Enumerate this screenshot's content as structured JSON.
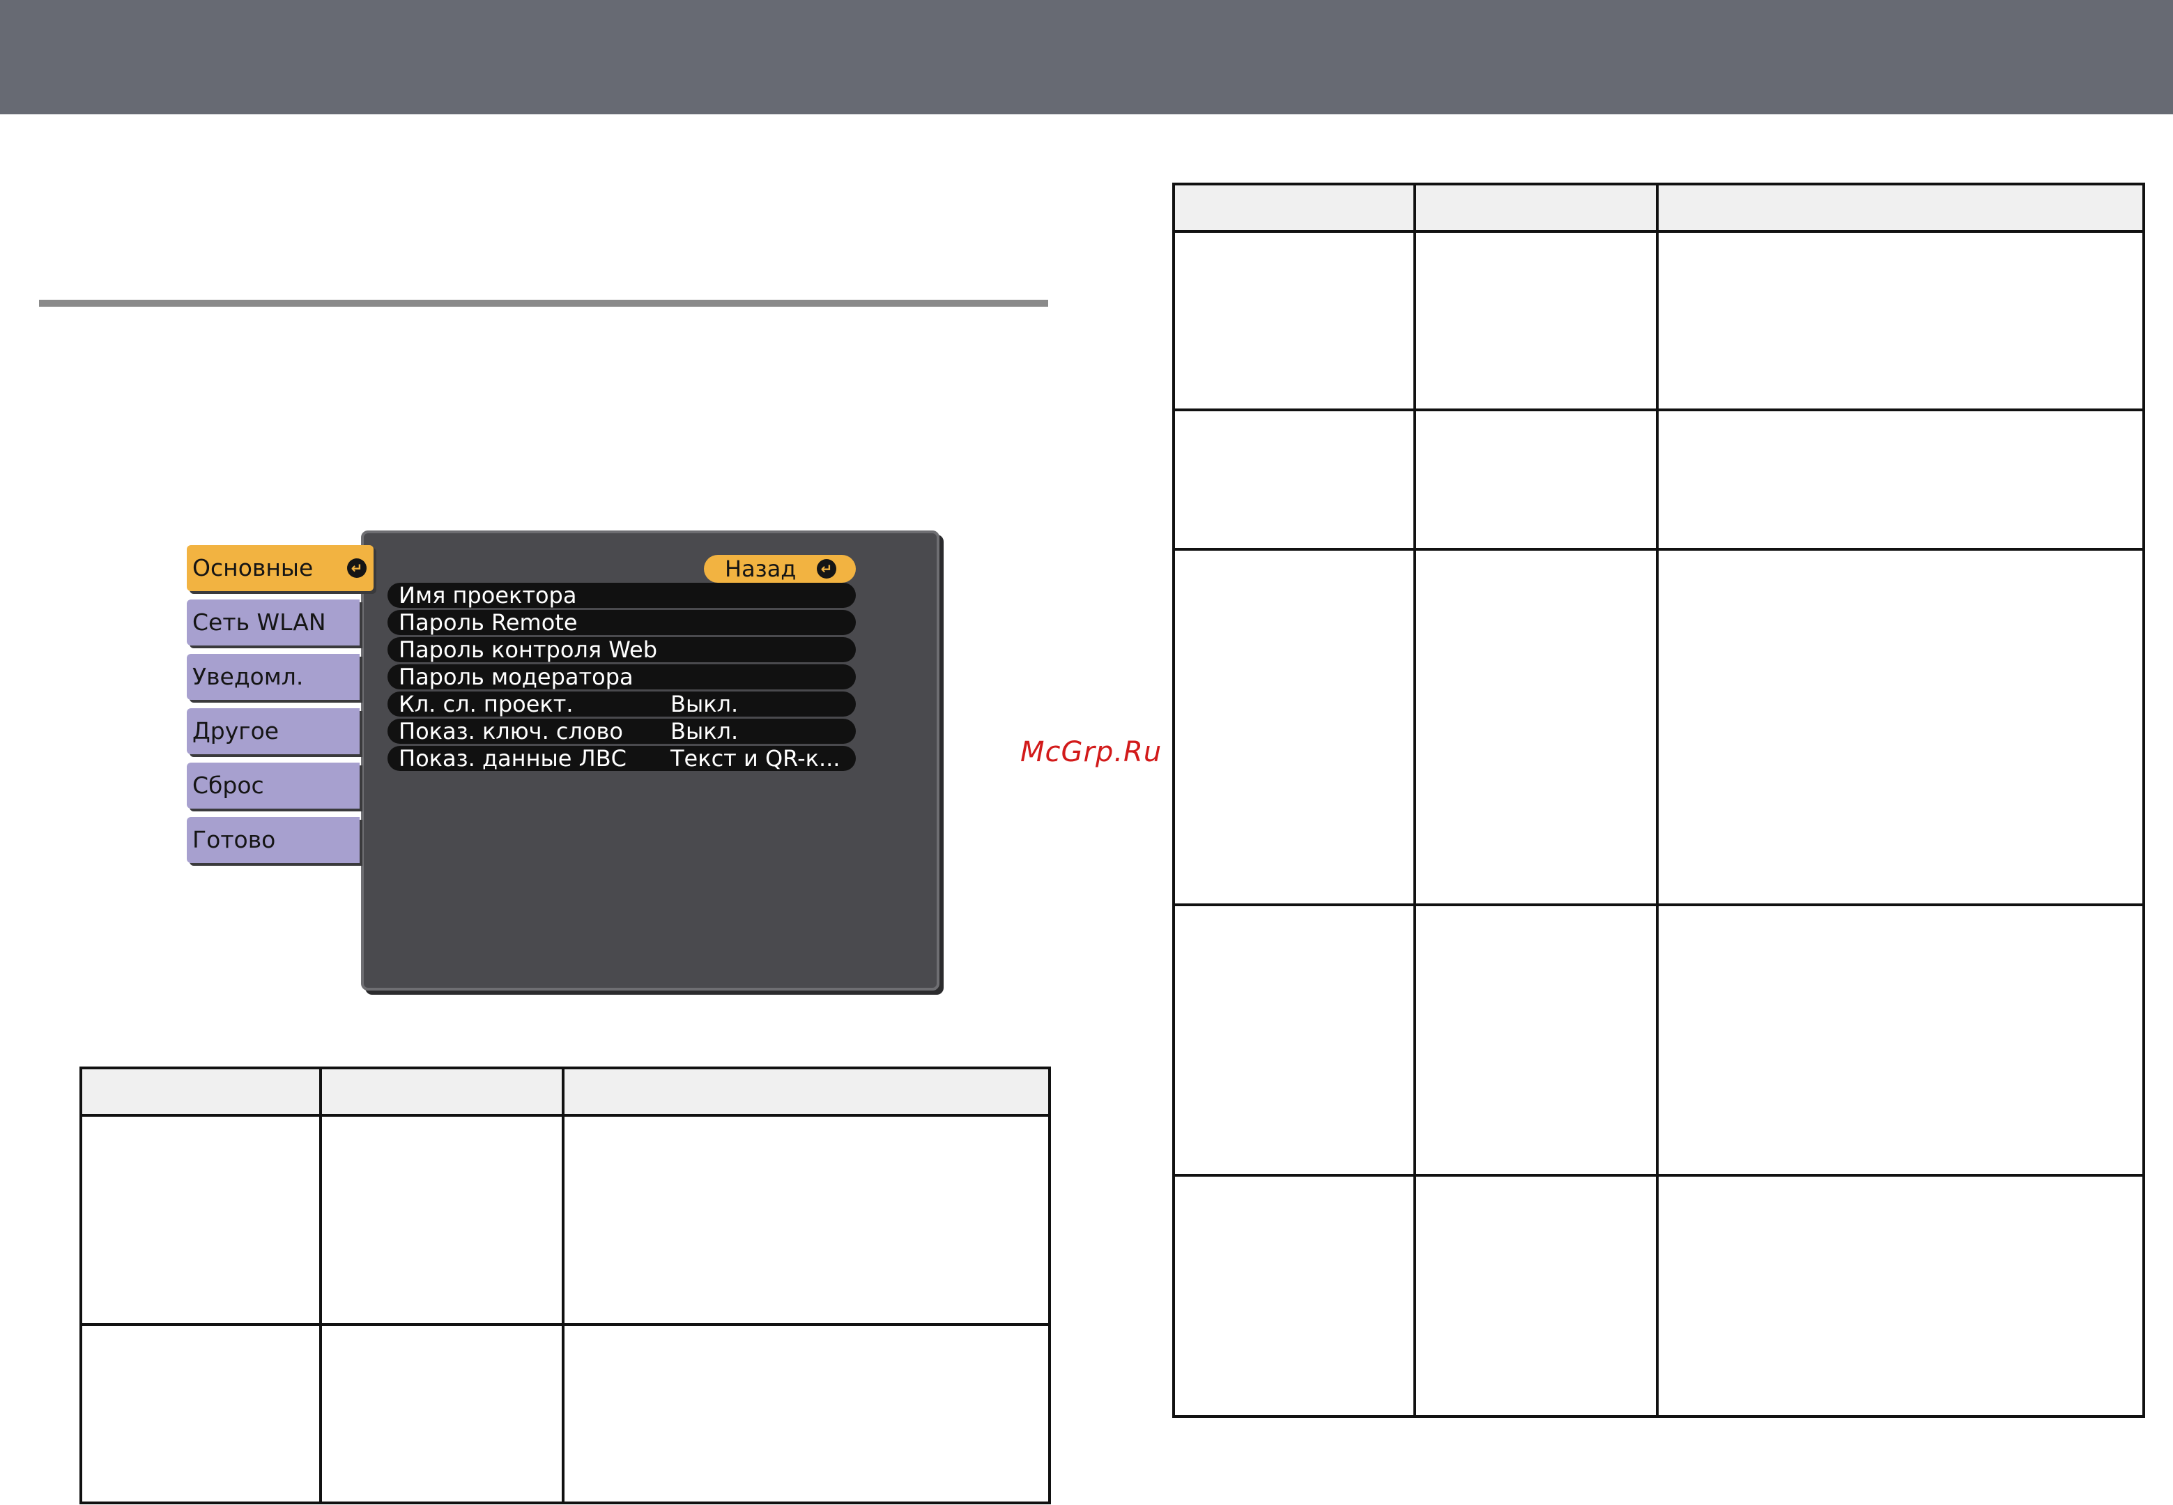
{
  "osd_menu": {
    "tabs": [
      {
        "label": "Основные",
        "active": true
      },
      {
        "label": "Сеть WLAN",
        "active": false
      },
      {
        "label": "Уведомл.",
        "active": false
      },
      {
        "label": "Другое",
        "active": false
      },
      {
        "label": "Сброс",
        "active": false
      },
      {
        "label": "Готово",
        "active": false
      }
    ],
    "back_label": "Назад",
    "items": [
      {
        "label": "Имя проектора",
        "value": ""
      },
      {
        "label": "Пароль Remote",
        "value": ""
      },
      {
        "label": "Пароль контроля Web",
        "value": ""
      },
      {
        "label": "Пароль модератора",
        "value": ""
      },
      {
        "label": "Кл. сл. проект.",
        "value": "Выкл."
      },
      {
        "label": "Показ. ключ. слово",
        "value": "Выкл."
      },
      {
        "label": "Показ. данные ЛВС",
        "value": "Текст и QR-к..."
      }
    ],
    "colors": {
      "active_tab": "#f2b341",
      "inactive_tab": "#a7a0cf",
      "panel": "#4a4a4e",
      "row": "#111111"
    },
    "icons": [
      "enter-icon"
    ]
  },
  "watermark": "McGrp.Ru",
  "tables": {
    "left_table": {
      "columns": 3,
      "header_cells": [
        "",
        "",
        ""
      ],
      "body_rows": 2
    },
    "right_table": {
      "columns": 3,
      "header_cells": [
        "",
        "",
        ""
      ],
      "body_rows": 5
    }
  },
  "colors": {
    "banner": "#676a73",
    "rule": "#8a8a8a",
    "watermark": "#d21a1a"
  }
}
